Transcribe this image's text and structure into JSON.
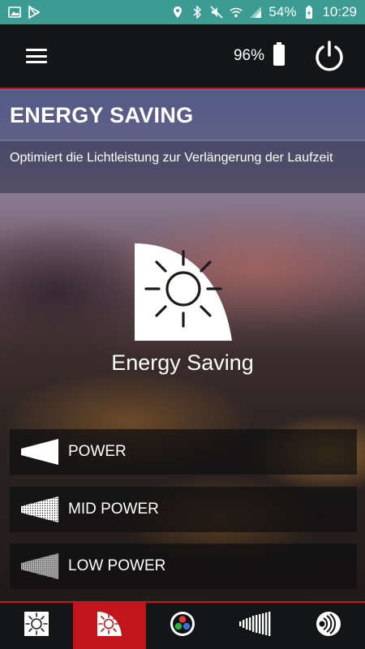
{
  "status_bar": {
    "battery": "54%",
    "time": "10:29",
    "background": "#3c9c93"
  },
  "header": {
    "menu_icon": "hamburger-menu-icon",
    "battery_level": "96%",
    "battery_icon": "battery-icon",
    "power_icon": "power-icon"
  },
  "page": {
    "title": "ENERGY SAVING",
    "description": "Optimiert die Lichtleistung zur Verlängerung der Laufzeit",
    "mode_label": "Energy Saving",
    "mode_icon": "energy-saving-sun-icon"
  },
  "options": [
    {
      "label": "POWER",
      "icon": "beam-full-icon"
    },
    {
      "label": "MID POWER",
      "icon": "beam-mid-icon"
    },
    {
      "label": "LOW POWER",
      "icon": "beam-low-icon"
    }
  ],
  "bottom_nav": {
    "tabs": [
      {
        "icon": "brightness-icon",
        "active": false
      },
      {
        "icon": "energy-saving-icon",
        "active": true
      },
      {
        "icon": "rgb-color-icon",
        "active": false
      },
      {
        "icon": "light-bars-icon",
        "active": false
      },
      {
        "icon": "signal-mode-icon",
        "active": false
      }
    ]
  },
  "colors": {
    "accent": "#c2151c",
    "bar": "#141516",
    "text": "#ffffff"
  }
}
